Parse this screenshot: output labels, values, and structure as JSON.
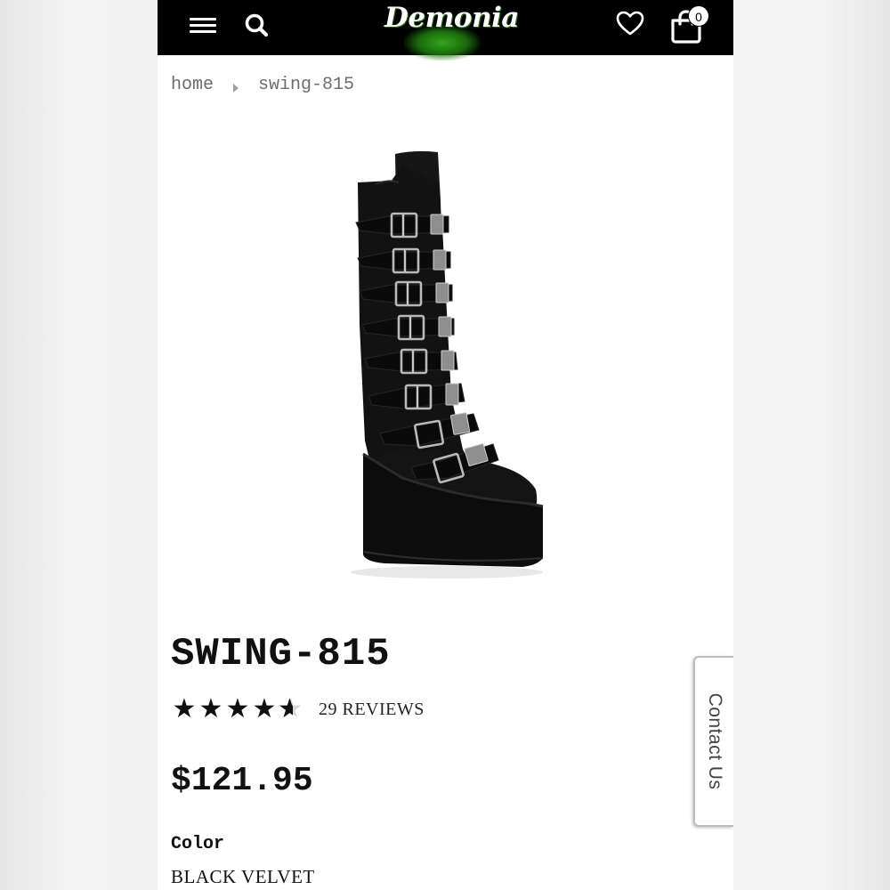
{
  "header": {
    "brand": "Demonia",
    "cart_count": "0"
  },
  "breadcrumb": {
    "home": "home",
    "current": "swing-815"
  },
  "product": {
    "title": "SWING-815",
    "rating": 4.5,
    "reviews_label": "29 REVIEWS",
    "price": "$121.95",
    "color_label": "Color",
    "color_value": "BLACK VELVET"
  },
  "contact_tab": {
    "label": "Contact Us"
  },
  "colors": {
    "header_bg": "#000000",
    "logo_glow": "#3cc21f",
    "text": "#111111",
    "breadcrumb": "#6d6d6d"
  },
  "icons": {
    "menu": "hamburger-icon",
    "search": "search-icon",
    "wishlist": "heart-icon",
    "cart": "shopping-bag-icon"
  }
}
